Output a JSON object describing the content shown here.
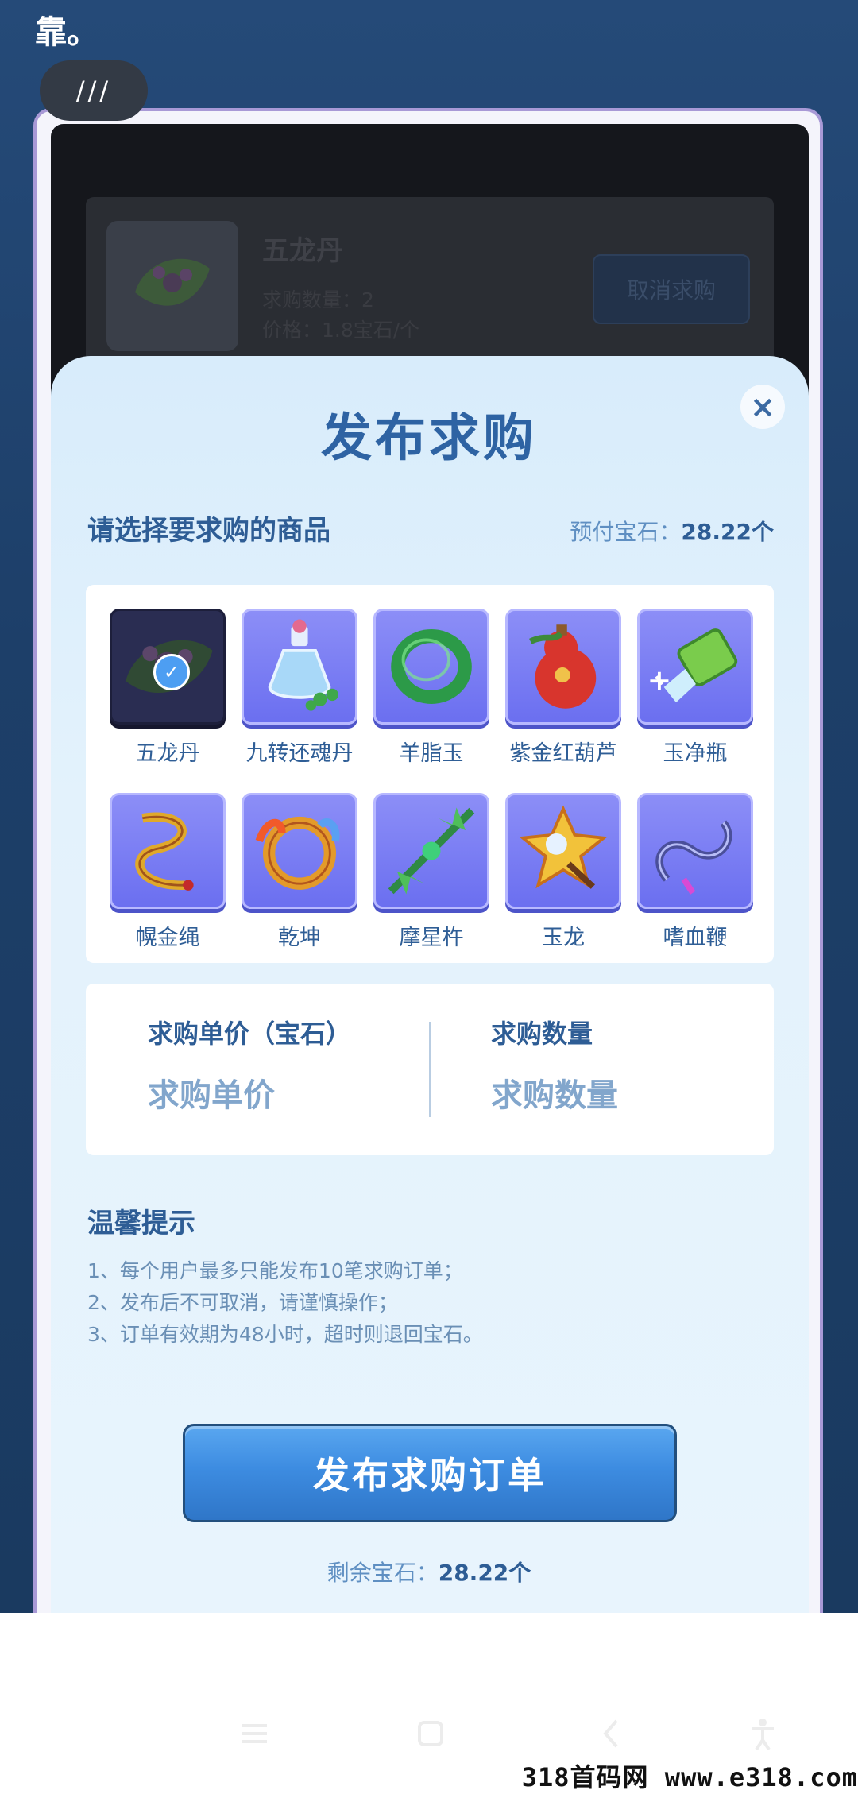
{
  "page": {
    "top_text": "靠。",
    "chip_label": "///"
  },
  "background_order": {
    "title": "五龙丹",
    "quantity_line": "求购数量：2",
    "price_line": "价格：1.8宝石/个",
    "cancel_label": "取消求购"
  },
  "sheet": {
    "title": "发布求购",
    "close_label": "×",
    "select_label": "请选择要求购的商品",
    "prepaid_label": "预付宝石：",
    "prepaid_value": "28.22个",
    "items": [
      {
        "label": "五龙丹",
        "icon": "leaf-pill-icon",
        "selected": true
      },
      {
        "label": "九转还魂丹",
        "icon": "potion-bottle-icon"
      },
      {
        "label": "羊脂玉",
        "icon": "jade-ring-icon"
      },
      {
        "label": "紫金红葫芦",
        "icon": "red-gourd-icon"
      },
      {
        "label": "玉净瓶",
        "icon": "jade-vase-icon"
      },
      {
        "label": "幌金绳",
        "icon": "golden-rope-icon"
      },
      {
        "label": "乾坤",
        "icon": "qiankun-circle-icon"
      },
      {
        "label": "摩星杵",
        "icon": "vajra-pestle-icon"
      },
      {
        "label": "玉龙",
        "icon": "jade-dragon-icon"
      },
      {
        "label": "嗜血鞭",
        "icon": "blood-whip-icon"
      }
    ],
    "unit_price_label": "求购单价（宝石）",
    "unit_price_placeholder": "求购单价",
    "quantity_label": "求购数量",
    "quantity_placeholder": "求购数量",
    "tips_title": "温馨提示",
    "tips": [
      "1、每个用户最多只能发布10笔求购订单；",
      "2、发布后不可取消，请谨慎操作；",
      "3、订单有效期为48小时，超时则退回宝石。"
    ],
    "submit_label": "发布求购订单",
    "remaining_label": "剩余宝石：",
    "remaining_value": "28.22个"
  },
  "navbar": {
    "icons": [
      "menu-icon",
      "home-square-icon",
      "back-chevron-icon",
      "accessibility-icon"
    ]
  },
  "watermark": "318首码网  www.e318.com"
}
